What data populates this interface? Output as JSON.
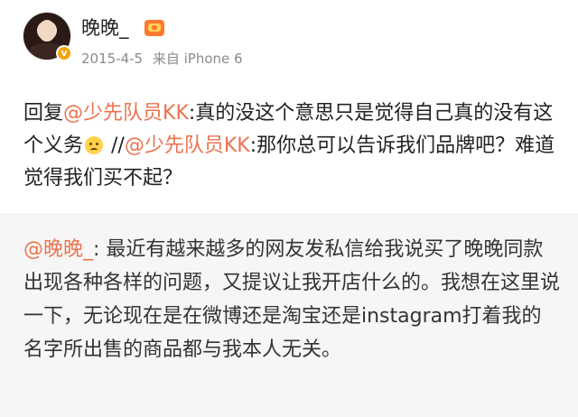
{
  "post": {
    "username": "晚晚_",
    "date": "2015-4-5",
    "source": "来自 iPhone 6",
    "verified_mark": "v",
    "reply_prefix": "回复",
    "reply_target": "@少先队员KK",
    "reply_body_1": ":真的没这个意思只是觉得自己真的没有这个义务",
    "emoji": "sad-face-emoji",
    "separator": " //",
    "quoted_target": "@少先队员KK",
    "quoted_body": ":那你总可以告诉我们品牌吧？难道觉得我们买不起？"
  },
  "repost": {
    "author": "@晚晚_",
    "body": ": 最近有越来越多的网友发私信给我说买了晚晚同款出现各种各样的问题，又提议让我开店什么的。我想在这里说一下，无论现在是在微博还是淘宝还是instagram打着我的名字所出售的商品都与我本人无关。"
  },
  "colors": {
    "mention": "#eb7350",
    "meta_text": "#8a8a8a",
    "repost_background": "#f6f6f6",
    "verified_badge": "#f7a400"
  }
}
